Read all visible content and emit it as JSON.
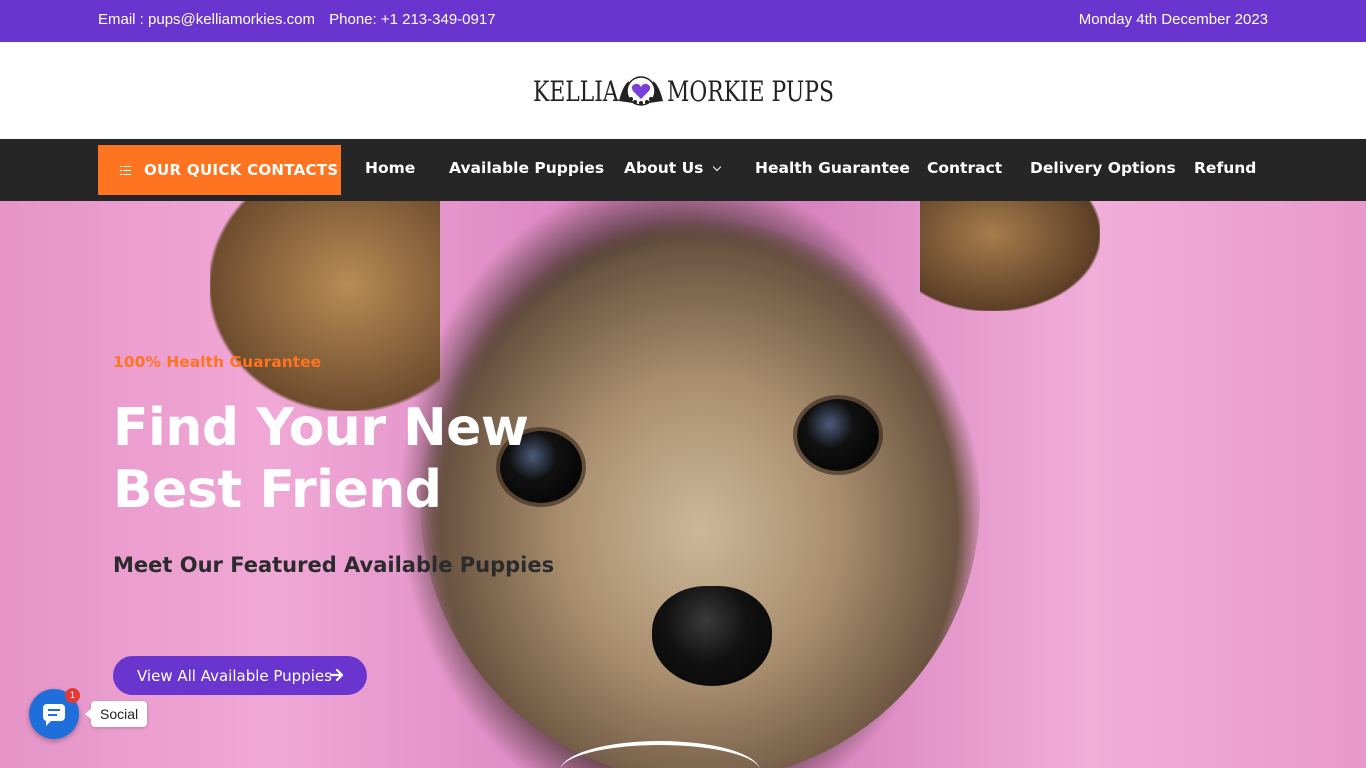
{
  "topbar": {
    "email": "Email :  pups@kelliamorkies.com",
    "phone": "Phone: +1 213-349-0917",
    "date": "Monday 4th December 2023"
  },
  "logo": {
    "part1": "KELLIA",
    "part2": "MORKIE PUPS",
    "emblem_icon": "paw-heart-emblem-icon"
  },
  "nav": {
    "quick_contacts": "OUR QUICK CONTACTS",
    "items": [
      {
        "label": "Home"
      },
      {
        "label": "Available Puppies"
      },
      {
        "label": "About Us"
      },
      {
        "label": "Health Guarantee"
      },
      {
        "label": "Contract"
      },
      {
        "label": "Delivery Options"
      },
      {
        "label": "Refund"
      }
    ]
  },
  "hero": {
    "tagline": "100% Health Guarantee",
    "headline_line1": "Find Your New",
    "headline_line2": "Best Friend",
    "subheading": "Meet Our Featured Available Puppies",
    "cta_label": "View All Available Puppies"
  },
  "social": {
    "label": "Social",
    "badge_count": "1"
  },
  "colors": {
    "brand_purple": "#6a35cf",
    "accent_orange": "#ff7420",
    "nav_dark": "#262626",
    "social_blue": "#1e6fd9"
  }
}
